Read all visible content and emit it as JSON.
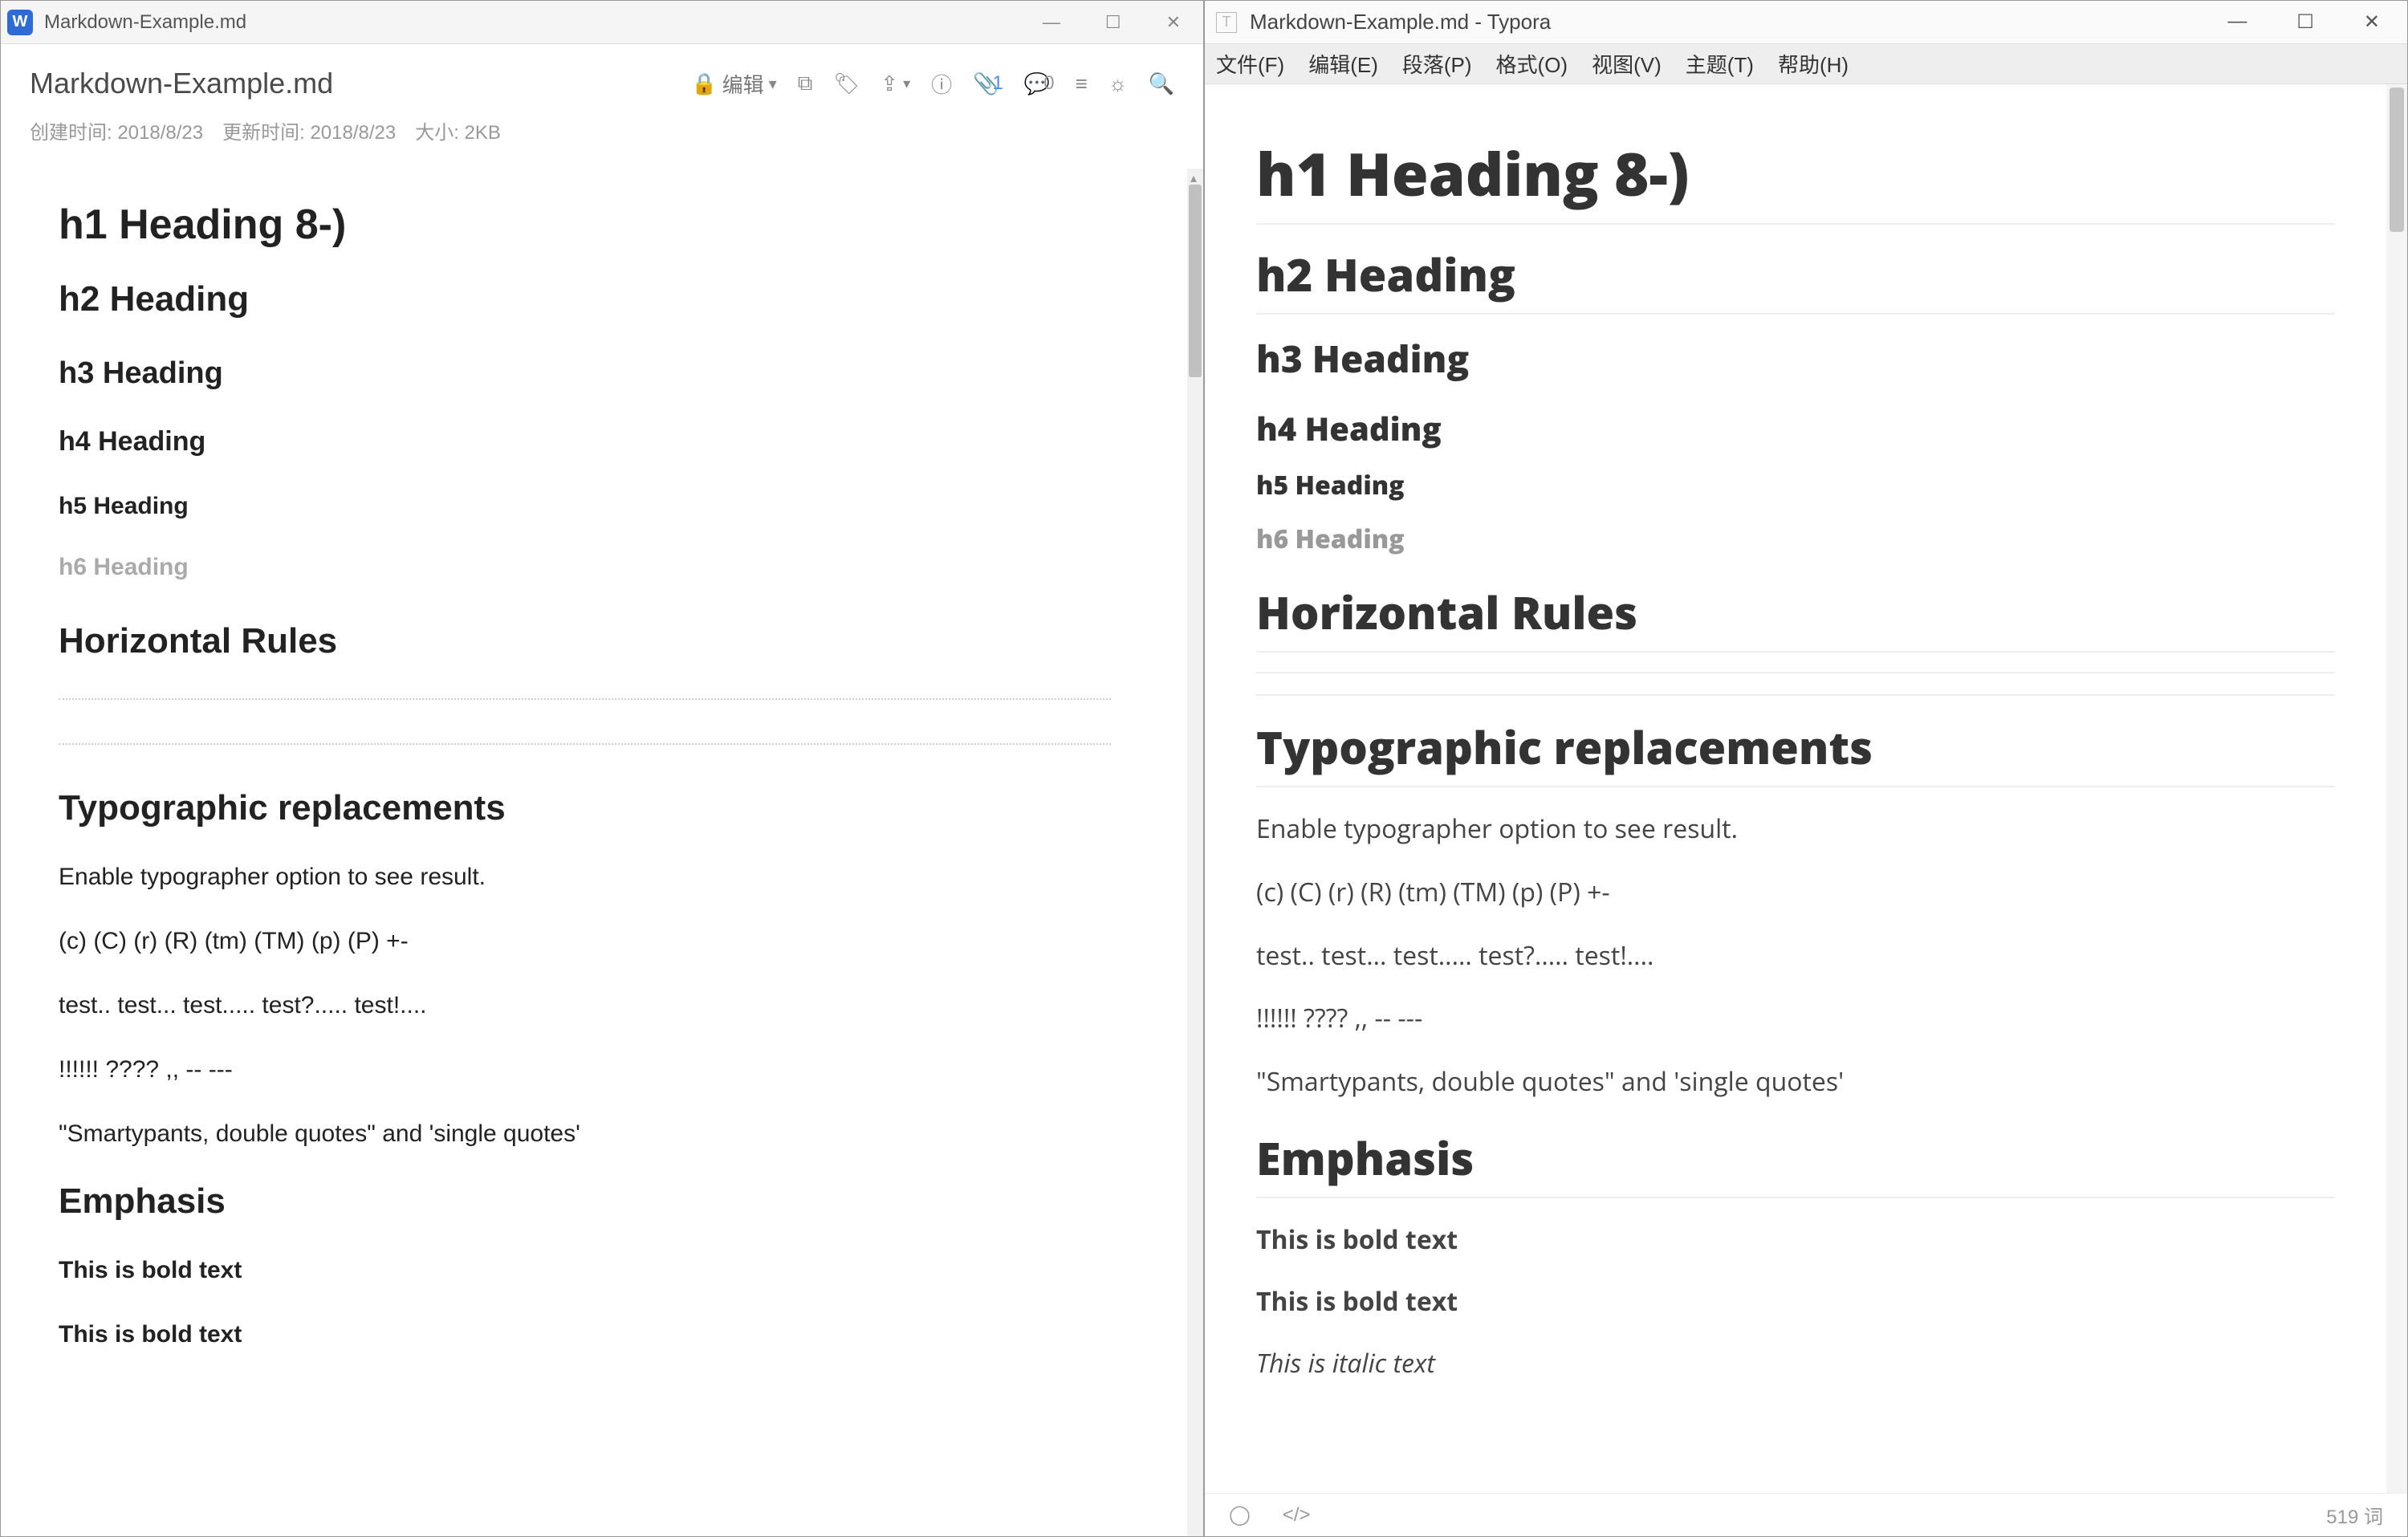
{
  "left": {
    "titlebar": {
      "filename": "Markdown-Example.md"
    },
    "header": {
      "title": "Markdown-Example.md",
      "edit_label": "编辑",
      "attach_count": "1",
      "comment_count": "0"
    },
    "meta": {
      "created": "创建时间: 2018/8/23",
      "updated": "更新时间: 2018/8/23",
      "size": "大小: 2KB"
    },
    "content": {
      "h1": "h1 Heading 8-)",
      "h2": "h2 Heading",
      "h3": "h3 Heading",
      "h4": "h4 Heading",
      "h5": "h5 Heading",
      "h6": "h6 Heading",
      "hr_title": "Horizontal Rules",
      "typo_title": "Typographic replacements",
      "typo_p1": "Enable typographer option to see result.",
      "typo_p2": "(c) (C) (r) (R) (tm) (TM) (p) (P) +-",
      "typo_p3": "test.. test... test..... test?..... test!....",
      "typo_p4": "!!!!!! ???? ,,  -- ---",
      "typo_p5": "\"Smartypants, double quotes\" and 'single quotes'",
      "emph_title": "Emphasis",
      "bold1": "This is bold text",
      "bold2": "This is bold text"
    }
  },
  "right": {
    "titlebar": {
      "title": "Markdown-Example.md - Typora"
    },
    "menu": {
      "file": "文件(F)",
      "edit": "编辑(E)",
      "paragraph": "段落(P)",
      "format": "格式(O)",
      "view": "视图(V)",
      "theme": "主题(T)",
      "help": "帮助(H)"
    },
    "content": {
      "h1": "h1 Heading 8-)",
      "h2": "h2 Heading",
      "h3": "h3 Heading",
      "h4": "h4 Heading",
      "h5": "h5 Heading",
      "h6": "h6 Heading",
      "hr_title": "Horizontal Rules",
      "typo_title": "Typographic replacements",
      "typo_p1": "Enable typographer option to see result.",
      "typo_p2": "(c) (C) (r) (R) (tm) (TM) (p) (P) +-",
      "typo_p3": "test.. test... test..... test?..... test!....",
      "typo_p4": "!!!!!! ???? ,,  -- ---",
      "typo_p5": "\"Smartypants, double quotes\" and 'single quotes'",
      "emph_title": "Emphasis",
      "bold1": "This is bold text",
      "bold2": "This is bold text",
      "italic1": "This is italic text"
    },
    "status": {
      "word_count": "519 词"
    }
  }
}
